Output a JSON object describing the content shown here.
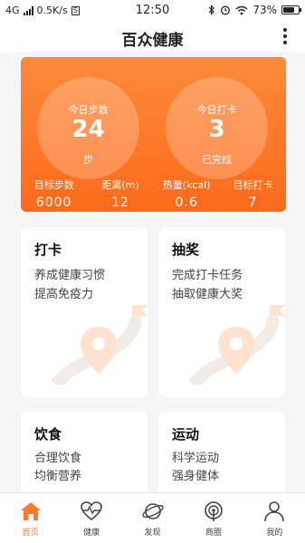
{
  "status": {
    "network": "4G",
    "speed": "0.5K/s",
    "time": "12:50",
    "battery": "73%",
    "battery_level": 0.73
  },
  "header": {
    "title": "百众健康"
  },
  "summary": {
    "steps_label": "今日步数",
    "steps_value": "24",
    "steps_unit": "步",
    "checkin_label": "今日打卡",
    "checkin_value": "3",
    "checkin_unit": "已完成",
    "stats": [
      {
        "label": "目标步数",
        "value": "6000"
      },
      {
        "label": "距离(m)",
        "value": "12"
      },
      {
        "label": "热量(kcal)",
        "value": "0.6"
      },
      {
        "label": "目标打卡",
        "value": "7"
      }
    ]
  },
  "cards": [
    {
      "title": "打卡",
      "line1": "养成健康习惯",
      "line2": "提高免疫力"
    },
    {
      "title": "抽奖",
      "line1": "完成打卡任务",
      "line2": "抽取健康大奖"
    },
    {
      "title": "饮食",
      "line1": "合理饮食",
      "line2": "均衡营养"
    },
    {
      "title": "运动",
      "line1": "科学运动",
      "line2": "强身健体"
    }
  ],
  "tabs": [
    {
      "label": "首页",
      "icon": "home-icon",
      "active": true
    },
    {
      "label": "健康",
      "icon": "heart-pulse-icon"
    },
    {
      "label": "发现",
      "icon": "planet-icon"
    },
    {
      "label": "商圈",
      "icon": "signal-icon"
    },
    {
      "label": "我的",
      "icon": "user-icon"
    }
  ],
  "colors": {
    "accent": "#ff7a2c",
    "hero_top": "#fb8a3a",
    "hero_bottom": "#ff6a1c"
  }
}
